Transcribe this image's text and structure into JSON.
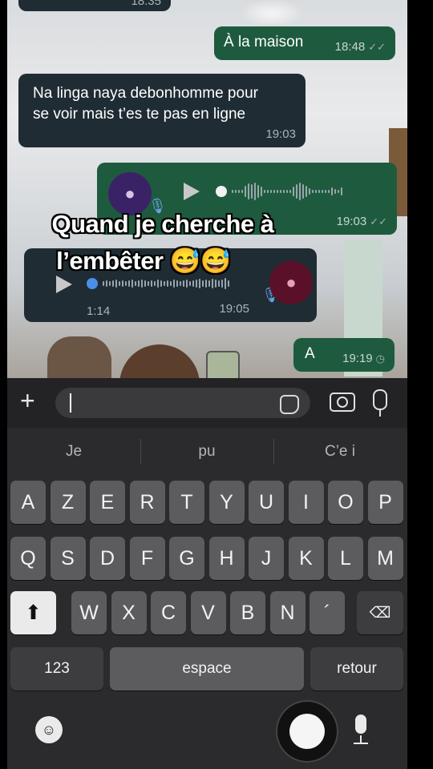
{
  "chat": {
    "msg_top": {
      "time": "18:35"
    },
    "msg1": {
      "text": "À la maison",
      "time": "18:48"
    },
    "msg2": {
      "line1": "Na linga naya debonhomme pour",
      "line2": "se voir mais t’es te pas en ligne",
      "time": "19:03"
    },
    "msg3": {
      "time": "19:03"
    },
    "msg4": {
      "duration": "1:14",
      "time": "19:05"
    },
    "msg5": {
      "text": "A",
      "time": "19:19"
    }
  },
  "overlay": {
    "line1": "Quand je cherche à",
    "line2": "l’embêter 😅😅"
  },
  "composer": {
    "placeholder": ""
  },
  "keyboard": {
    "suggestions": [
      "Je",
      "pu",
      "C’e i"
    ],
    "row1": [
      "A",
      "Z",
      "E",
      "R",
      "T",
      "Y",
      "U",
      "I",
      "O",
      "P"
    ],
    "row2": [
      "Q",
      "S",
      "D",
      "F",
      "G",
      "H",
      "J",
      "K",
      "L",
      "M"
    ],
    "row3": [
      "W",
      "X",
      "C",
      "V",
      "B",
      "N",
      "´"
    ],
    "num_label": "123",
    "space_label": "espace",
    "return_label": "retour"
  },
  "colors": {
    "out_bubble": "#1e5b3e",
    "in_bubble": "#1f2c34",
    "accent_blue": "#6aa3e8"
  }
}
